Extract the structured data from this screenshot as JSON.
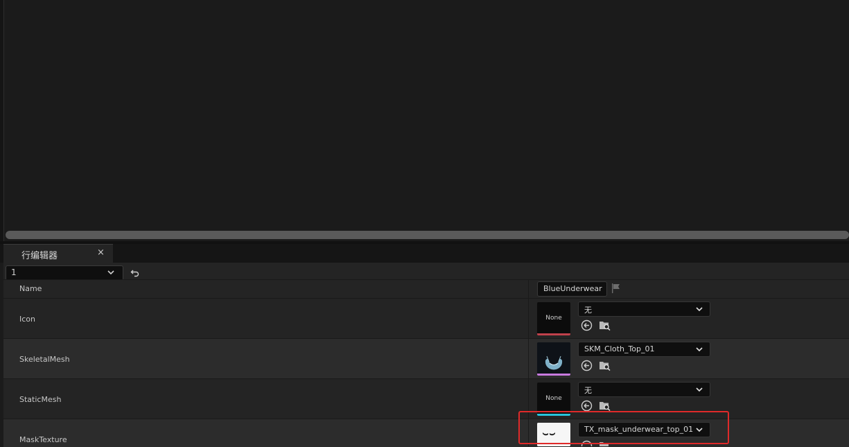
{
  "tab": {
    "title": "行编辑器",
    "close": "×"
  },
  "row_selector": {
    "value": "1"
  },
  "fields": {
    "name": {
      "label": "Name",
      "value": "BlueUnderwear"
    },
    "icon": {
      "label": "Icon",
      "thumb": "None",
      "value": "无",
      "accent": "#c0414b"
    },
    "skeletal_mesh": {
      "label": "SkeletalMesh",
      "value": "SKM_Cloth_Top_01",
      "accent": "#c87adf"
    },
    "static_mesh": {
      "label": "StaticMesh",
      "thumb": "None",
      "value": "无",
      "accent": "#27c4dc"
    },
    "mask_texture": {
      "label": "MaskTexture",
      "value": "TX_mask_underwear_top_01"
    }
  },
  "colors": {
    "highlight": "#e02a2a"
  }
}
